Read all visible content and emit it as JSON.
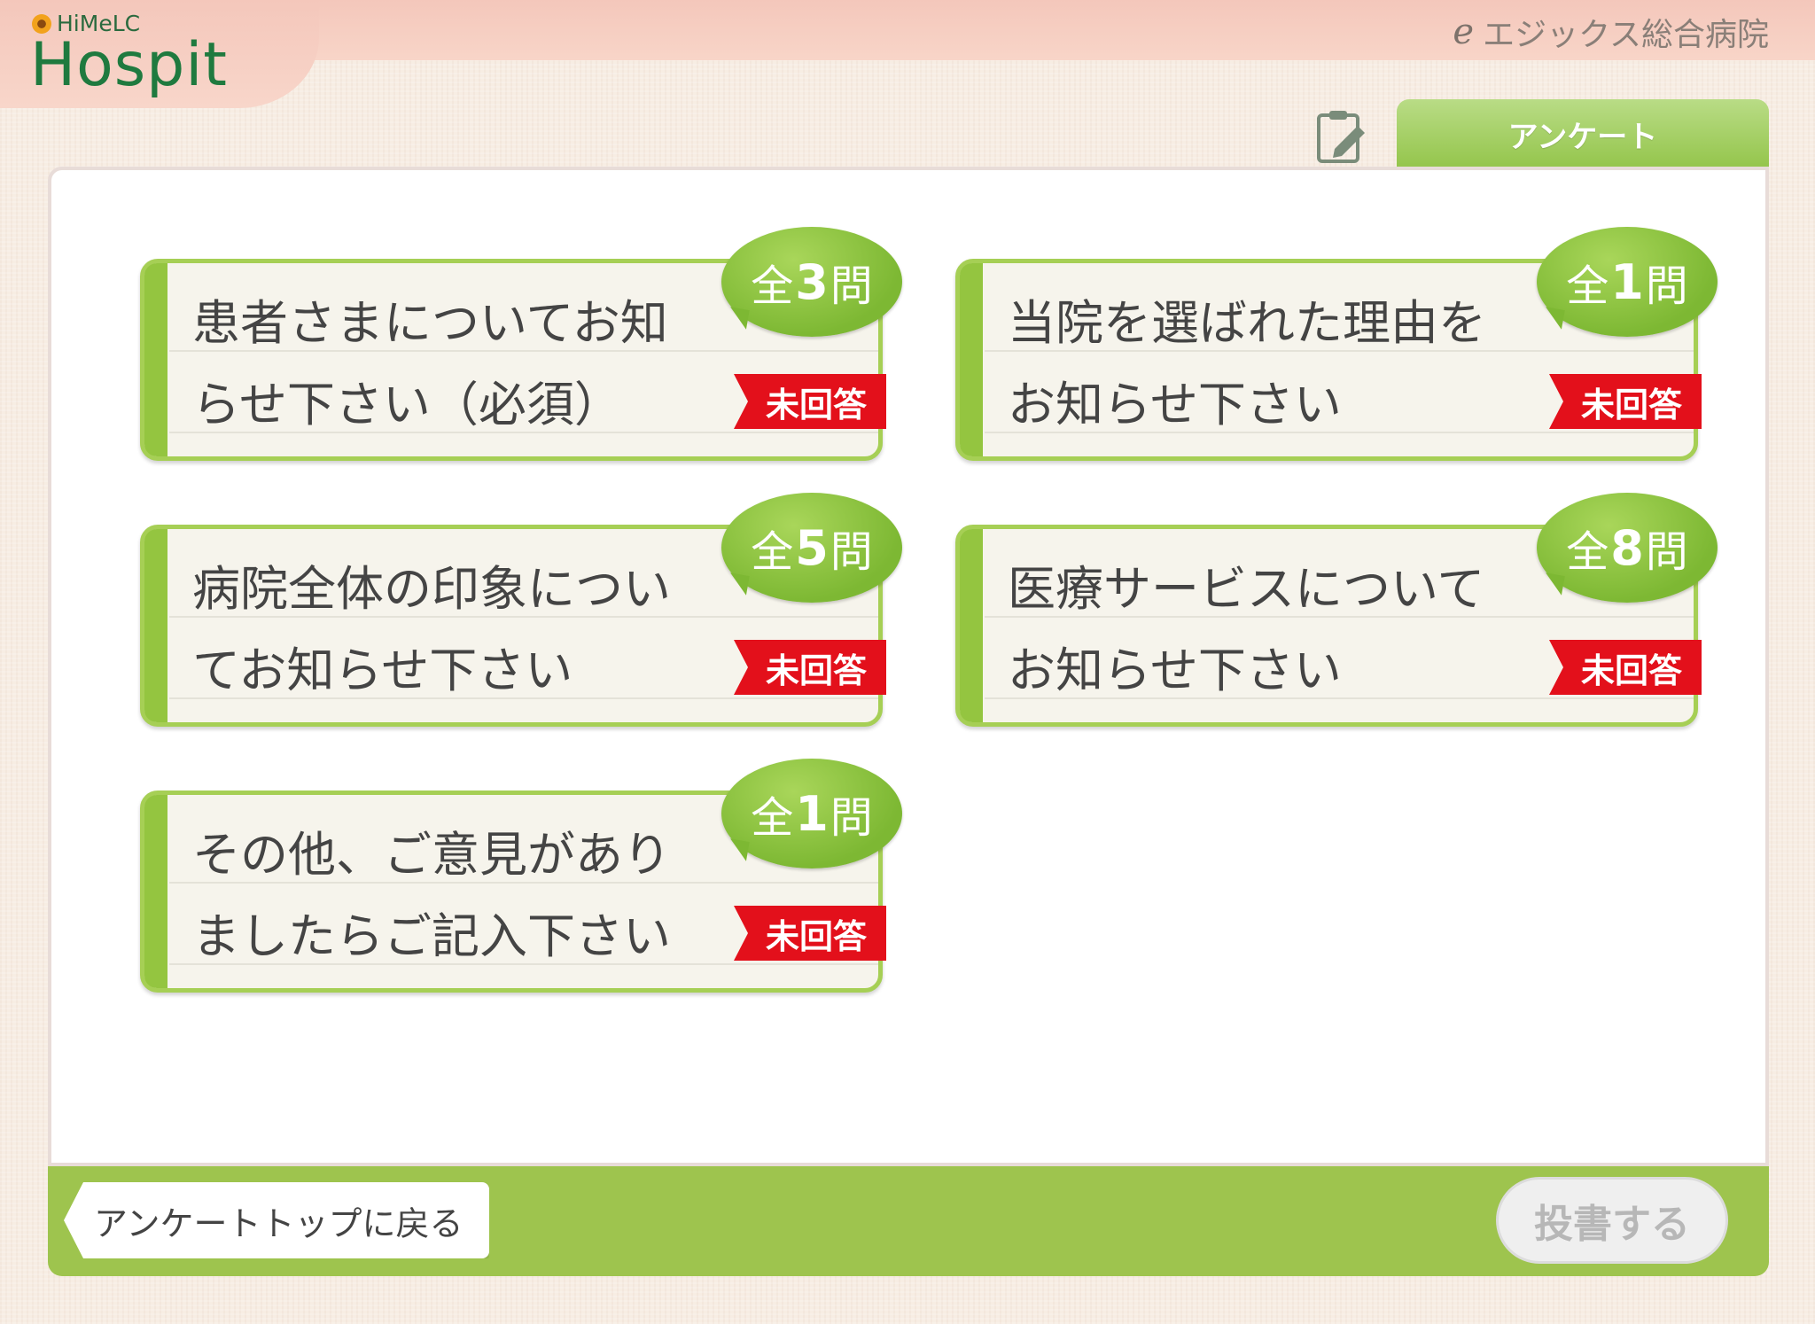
{
  "header": {
    "brand_small": "HiMeLC",
    "brand_big": "Hospit",
    "hospital_name": "エジックス総合病院",
    "hospital_logo_glyph": "e"
  },
  "tabs": {
    "active_label": "アンケート"
  },
  "surveys": [
    {
      "title_line1": "患者さまについてお知",
      "title_line2": "らせ下さい（必須）",
      "prefix": "全",
      "count": "3",
      "suffix": "問",
      "status": "未回答"
    },
    {
      "title_line1": "当院を選ばれた理由を",
      "title_line2": "お知らせ下さい",
      "prefix": "全",
      "count": "1",
      "suffix": "問",
      "status": "未回答"
    },
    {
      "title_line1": "病院全体の印象につい",
      "title_line2": "てお知らせ下さい",
      "prefix": "全",
      "count": "5",
      "suffix": "問",
      "status": "未回答"
    },
    {
      "title_line1": "医療サービスについて",
      "title_line2": "お知らせ下さい",
      "prefix": "全",
      "count": "8",
      "suffix": "問",
      "status": "未回答"
    },
    {
      "title_line1": "その他、ご意見があり",
      "title_line2": "ましたらご記入下さい",
      "prefix": "全",
      "count": "1",
      "suffix": "問",
      "status": "未回答"
    }
  ],
  "footer": {
    "back_label": "アンケートトップに戻る",
    "submit_label": "投書する"
  },
  "colors": {
    "accent_green": "#94c540",
    "status_red": "#e3101b",
    "header_pink": "#f4c7bb"
  }
}
